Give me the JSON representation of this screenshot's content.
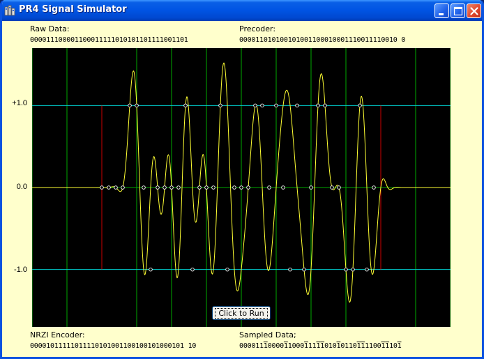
{
  "window": {
    "title": "PR4 Signal Simulator"
  },
  "labels": {
    "raw": "Raw Data:",
    "precoder": "Precoder:",
    "nrzi": "NRZI Encoder:",
    "sampled": "Sampled Data;"
  },
  "values": {
    "raw": "000011100001100011111010101101111001101",
    "precoder": "000011010100101001100010001110011110010 0",
    "nrzi": "00001011111011110101001100100101000101 10",
    "sampled": "000011T0000T1000T11TT010T0110TT1100TT10T"
  },
  "button": {
    "run": "Click to Run"
  },
  "colors": {
    "background": "#000000",
    "signal": "#ffff33",
    "grid": "#00aa00",
    "level": "#00c8c8",
    "window_marker": "#cc0000",
    "sample_point": "#ffffff"
  },
  "chart_data": {
    "type": "line",
    "title": "",
    "xlabel": "",
    "ylabel": "",
    "ylim": [
      -1.7,
      1.7
    ],
    "xlim": [
      -2,
      10
    ],
    "y_ticks": [
      "+1.0",
      "0.0",
      "-1.0"
    ],
    "y_tick_values": [
      1,
      0,
      -1
    ],
    "grid": true,
    "sample_period": 0.2,
    "window": [
      0,
      8
    ],
    "series": [
      {
        "kind": "signal",
        "values": [
          0,
          0,
          0,
          0,
          1,
          1,
          0,
          1,
          0,
          1,
          0,
          0,
          1,
          0,
          1,
          0,
          0,
          1,
          1,
          0,
          0,
          0,
          1,
          0,
          0,
          0,
          1,
          1,
          1,
          0,
          0,
          1,
          1,
          1,
          1,
          0,
          0,
          1,
          0,
          0
        ]
      }
    ],
    "samples": [
      0,
      0,
      0,
      0,
      1,
      1,
      0,
      -1,
      0,
      0,
      0,
      0,
      1,
      -1,
      0,
      0,
      0,
      1,
      -1,
      0,
      0,
      0,
      1,
      1,
      0,
      1,
      0,
      -1,
      1,
      -1,
      0,
      1,
      1,
      0,
      0,
      -1,
      -1,
      1,
      -1,
      0
    ]
  }
}
